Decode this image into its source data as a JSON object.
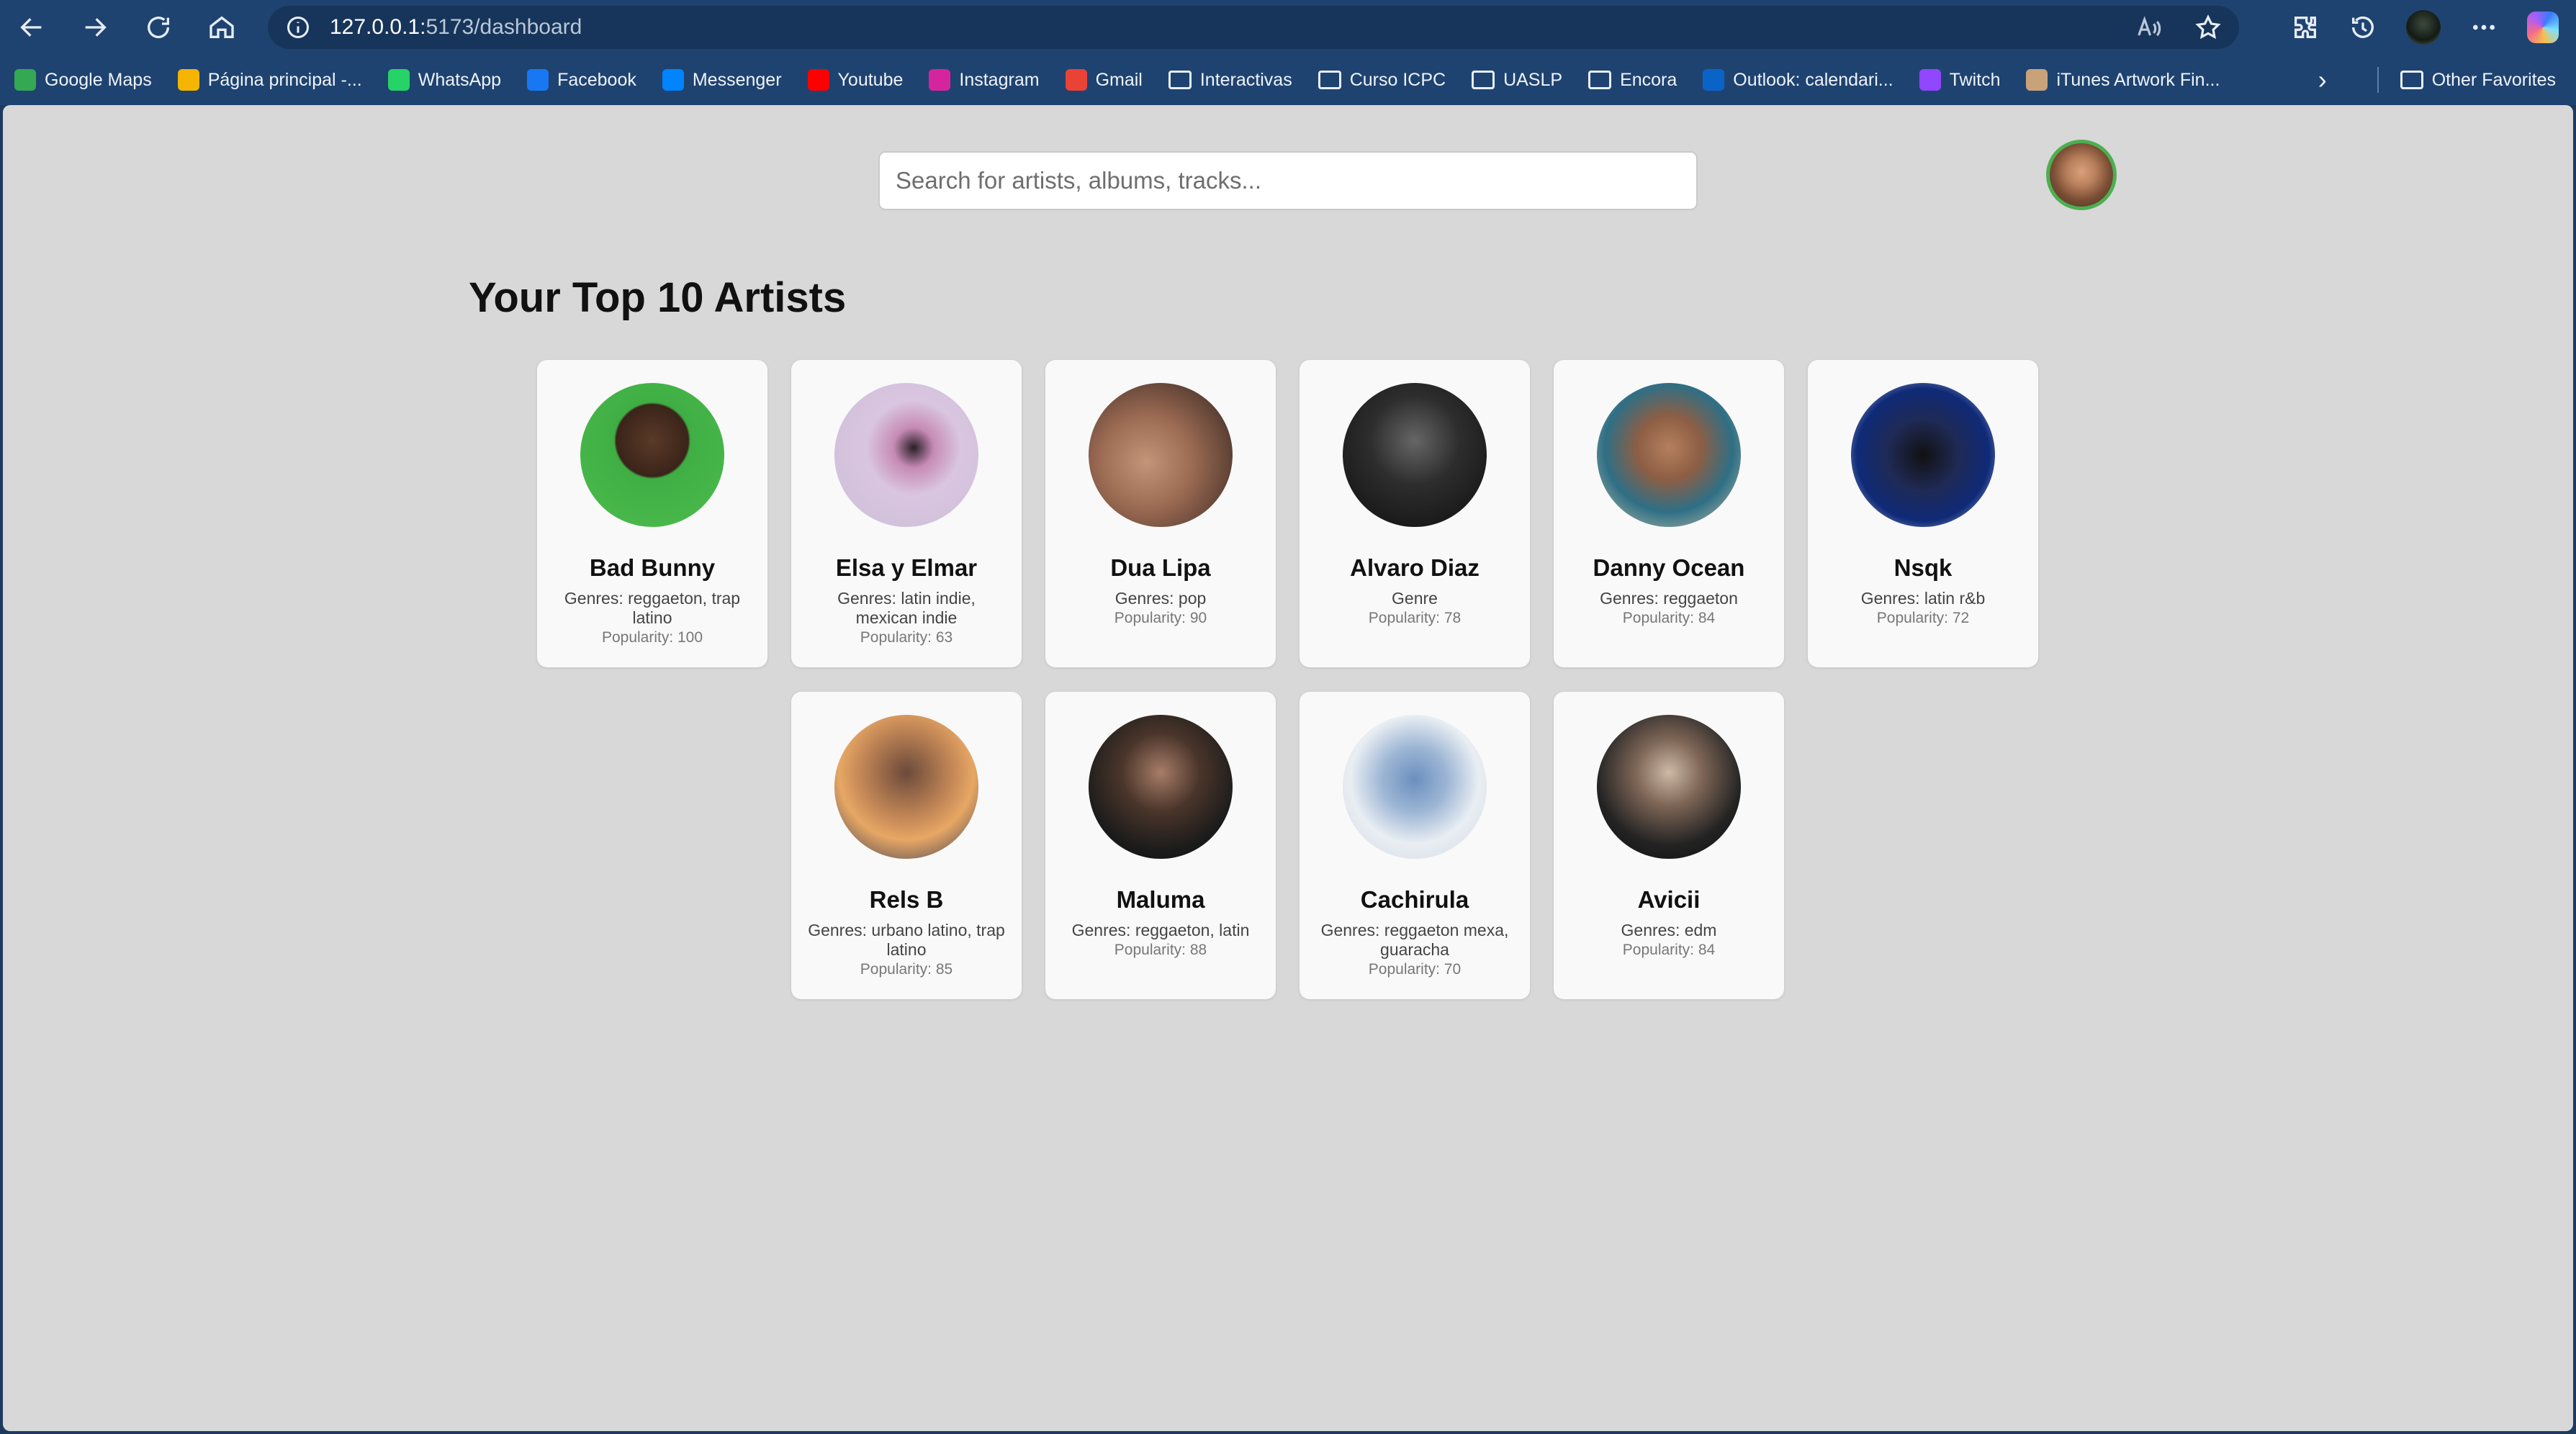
{
  "browser": {
    "url_host": "127.0.0.1:",
    "url_path": "5173/dashboard",
    "bookmarks": [
      {
        "label": "Google Maps",
        "icon": "google-maps-icon",
        "color": "#34a853"
      },
      {
        "label": "Página principal -...",
        "icon": "google-drive-icon",
        "color": "#f4b400"
      },
      {
        "label": "WhatsApp",
        "icon": "whatsapp-icon",
        "color": "#25d366"
      },
      {
        "label": "Facebook",
        "icon": "facebook-icon",
        "color": "#1877f2"
      },
      {
        "label": "Messenger",
        "icon": "messenger-icon",
        "color": "#0084ff"
      },
      {
        "label": "Youtube",
        "icon": "youtube-icon",
        "color": "#ff0000"
      },
      {
        "label": "Instagram",
        "icon": "instagram-icon",
        "color": "#d6249f"
      },
      {
        "label": "Gmail",
        "icon": "gmail-icon",
        "color": "#ea4335"
      },
      {
        "label": "Interactivas",
        "icon": "folder-icon",
        "color": ""
      },
      {
        "label": "Curso ICPC",
        "icon": "folder-icon",
        "color": ""
      },
      {
        "label": "UASLP",
        "icon": "folder-icon",
        "color": ""
      },
      {
        "label": "Encora",
        "icon": "folder-icon",
        "color": ""
      },
      {
        "label": "Outlook: calendari...",
        "icon": "outlook-icon",
        "color": "#0a64c8"
      },
      {
        "label": "Twitch",
        "icon": "twitch-icon",
        "color": "#9146ff"
      },
      {
        "label": "iTunes Artwork Fin...",
        "icon": "itunes-artwork-icon",
        "color": "#c9a27a"
      }
    ],
    "other_favorites": "Other Favorites"
  },
  "page": {
    "search_placeholder": "Search for artists, albums, tracks...",
    "heading": "Your Top 10 Artists",
    "artists": [
      {
        "name": "Bad Bunny",
        "genres": "Genres: reggaeton, trap latino",
        "popularity": "Popularity: 100"
      },
      {
        "name": "Elsa y Elmar",
        "genres": "Genres: latin indie, mexican indie",
        "popularity": "Popularity: 63"
      },
      {
        "name": "Dua Lipa",
        "genres": "Genres: pop",
        "popularity": "Popularity: 90"
      },
      {
        "name": "Alvaro Diaz",
        "genres": "Genre",
        "popularity": "Popularity: 78"
      },
      {
        "name": "Danny Ocean",
        "genres": "Genres: reggaeton",
        "popularity": "Popularity: 84"
      },
      {
        "name": "Nsqk",
        "genres": "Genres: latin r&b",
        "popularity": "Popularity: 72"
      },
      {
        "name": "Rels B",
        "genres": "Genres: urbano latino, trap latino",
        "popularity": "Popularity: 85"
      },
      {
        "name": "Maluma",
        "genres": "Genres: reggaeton, latin",
        "popularity": "Popularity: 88"
      },
      {
        "name": "Cachirula",
        "genres": "Genres: reggaeton mexa, guaracha",
        "popularity": "Popularity: 70"
      },
      {
        "name": "Avicii",
        "genres": "Genres: edm",
        "popularity": "Popularity: 84"
      }
    ]
  },
  "colors": {
    "chrome": "#1f4370",
    "page_bg": "#d8d8d8",
    "card_bg": "#f9f9f9",
    "avatar_ring": "#4caf50"
  }
}
